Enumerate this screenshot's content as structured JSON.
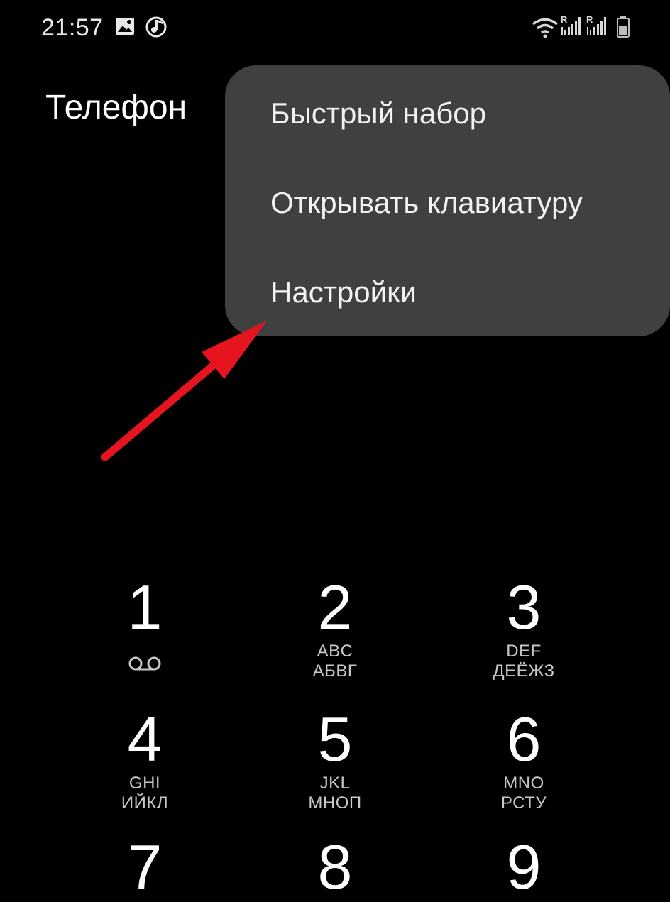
{
  "status_bar": {
    "time": "21:57",
    "icons": [
      "gallery-icon",
      "music-note-icon",
      "wifi-icon",
      "signal-roaming-icon",
      "signal-roaming-icon",
      "battery-icon"
    ],
    "roaming_label": "R"
  },
  "app": {
    "title": "Телефон"
  },
  "menu": {
    "items": [
      {
        "label": "Быстрый набор"
      },
      {
        "label": "Открывать клавиатуру"
      },
      {
        "label": "Настройки"
      }
    ]
  },
  "annotation": {
    "arrow_color": "#e5141e"
  },
  "dialpad": {
    "keys": [
      {
        "digit": "1",
        "line1": "",
        "line2": "",
        "icon": "voicemail-icon"
      },
      {
        "digit": "2",
        "line1": "ABC",
        "line2": "АБВГ"
      },
      {
        "digit": "3",
        "line1": "DEF",
        "line2": "ДЕЁЖЗ"
      },
      {
        "digit": "4",
        "line1": "GHI",
        "line2": "ИЙКЛ"
      },
      {
        "digit": "5",
        "line1": "JKL",
        "line2": "МНОП"
      },
      {
        "digit": "6",
        "line1": "MNO",
        "line2": "РСТУ"
      },
      {
        "digit": "7"
      },
      {
        "digit": "8"
      },
      {
        "digit": "9"
      }
    ]
  }
}
